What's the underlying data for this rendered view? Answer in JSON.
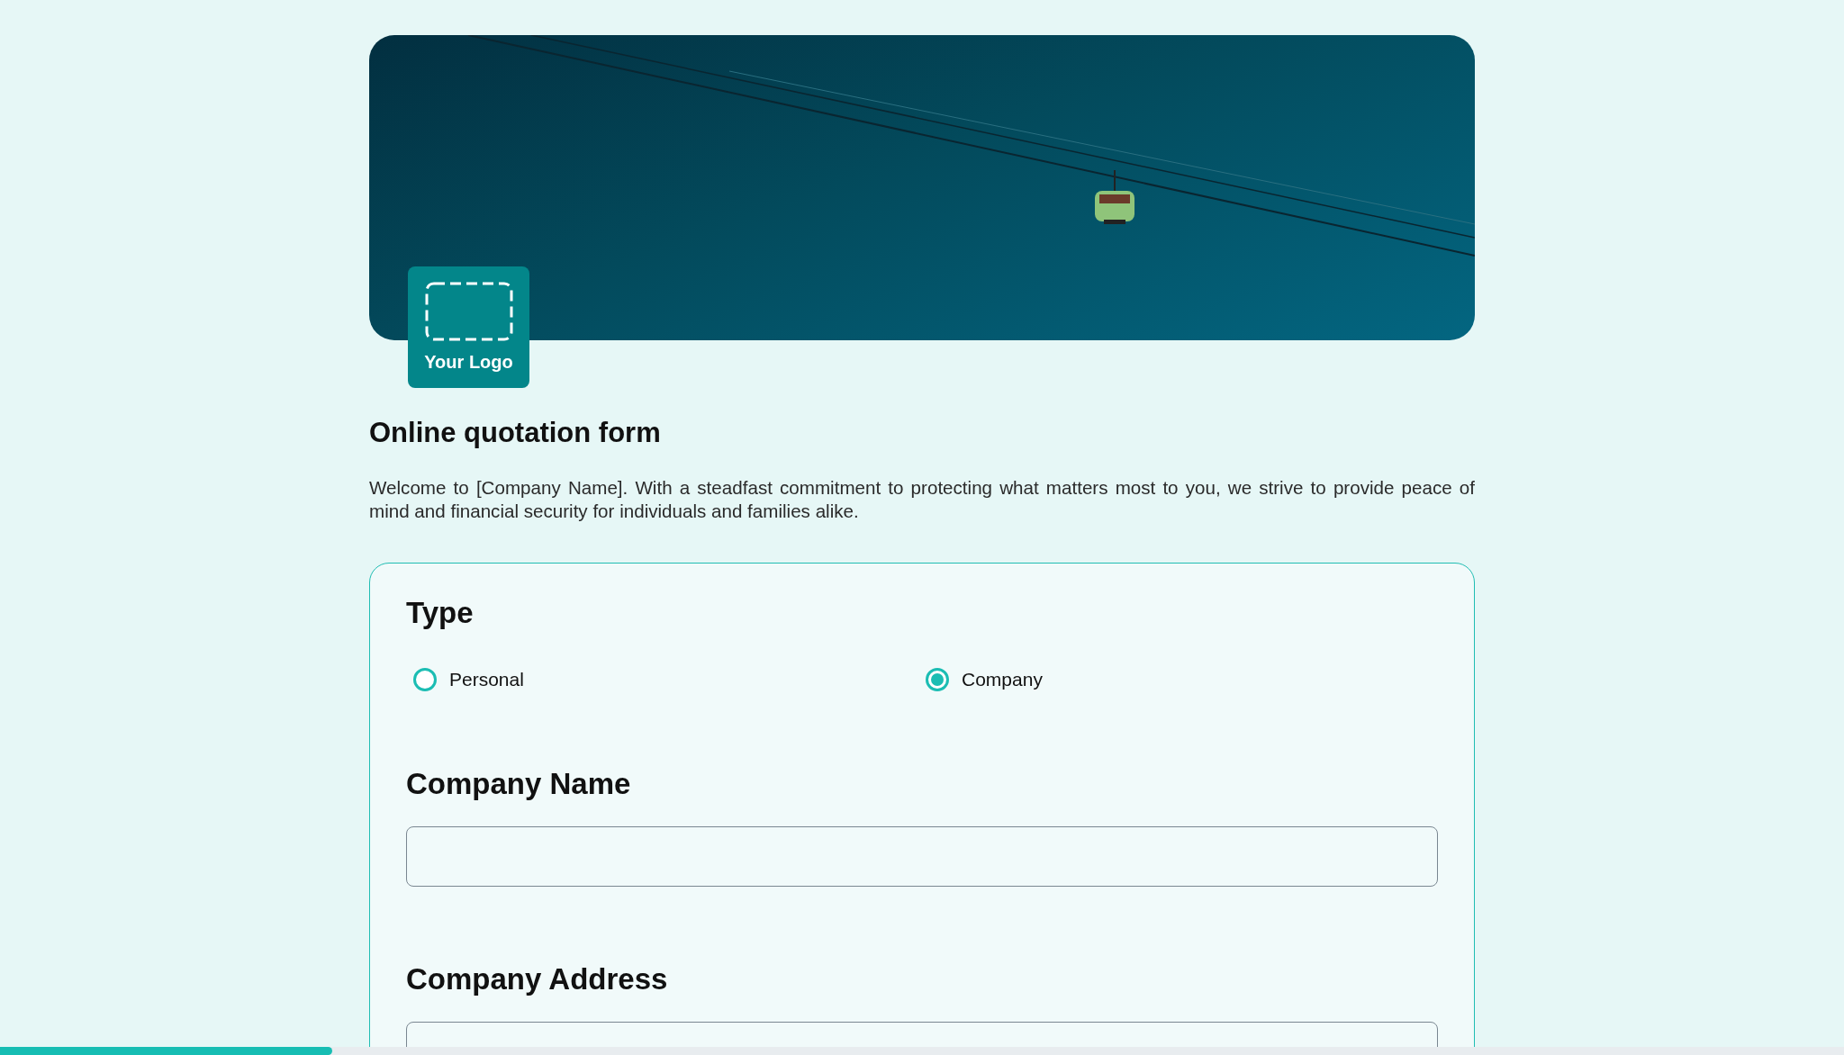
{
  "header": {
    "logo_text": "Your Logo"
  },
  "title": "Online quotation form",
  "intro": "Welcome to [Company Name]. With a steadfast commitment to protecting what matters most to you, we strive to provide peace of mind and financial security for individuals and families alike.",
  "form": {
    "type": {
      "label": "Type",
      "options": [
        {
          "label": "Personal",
          "selected": false
        },
        {
          "label": "Company",
          "selected": true
        }
      ]
    },
    "fields": [
      {
        "label": "Company Name"
      },
      {
        "label": "Company Address"
      }
    ]
  },
  "progress": {
    "level": 0.18
  }
}
